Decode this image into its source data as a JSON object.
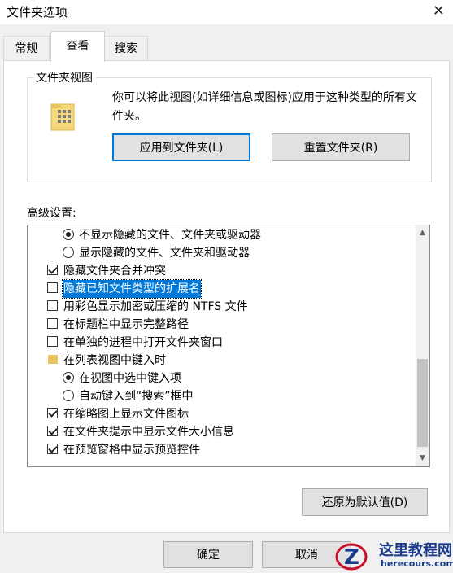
{
  "window": {
    "title": "文件夹选项"
  },
  "tabs": [
    "常规",
    "查看",
    "搜索"
  ],
  "folder_views": {
    "group_label": "文件夹视图",
    "description": "你可以将此视图(如详细信息或图标)应用于这种类型的所有文件夹。",
    "apply_button": "应用到文件夹(L)",
    "reset_button": "重置文件夹(R)"
  },
  "advanced": {
    "label": "高级设置:",
    "items": [
      {
        "type": "radio",
        "checked": true,
        "label": "不显示隐藏的文件、文件夹或驱动器"
      },
      {
        "type": "radio",
        "checked": false,
        "label": "显示隐藏的文件、文件夹和驱动器"
      },
      {
        "type": "checkbox",
        "checked": true,
        "label": "隐藏文件夹合并冲突"
      },
      {
        "type": "checkbox",
        "checked": false,
        "label": "隐藏已知文件类型的扩展名",
        "selected": true
      },
      {
        "type": "checkbox",
        "checked": false,
        "label": "用彩色显示加密或压缩的 NTFS 文件"
      },
      {
        "type": "checkbox",
        "checked": false,
        "label": "在标题栏中显示完整路径"
      },
      {
        "type": "checkbox",
        "checked": false,
        "label": "在单独的进程中打开文件夹窗口"
      },
      {
        "type": "folder",
        "label": "在列表视图中键入时"
      },
      {
        "type": "radio",
        "checked": true,
        "label": "在视图中选中键入项"
      },
      {
        "type": "radio",
        "checked": false,
        "label": "自动键入到“搜索”框中"
      },
      {
        "type": "checkbox",
        "checked": true,
        "label": "在缩略图上显示文件图标"
      },
      {
        "type": "checkbox",
        "checked": true,
        "label": "在文件夹提示中显示文件大小信息"
      },
      {
        "type": "checkbox",
        "checked": true,
        "label": "在预览窗格中显示预览控件"
      }
    ]
  },
  "restore_button": "还原为默认值(D)",
  "ok_button": "确定",
  "cancel_button": "取消",
  "watermark": {
    "title": "这里教程网",
    "url": "herecours.com"
  }
}
